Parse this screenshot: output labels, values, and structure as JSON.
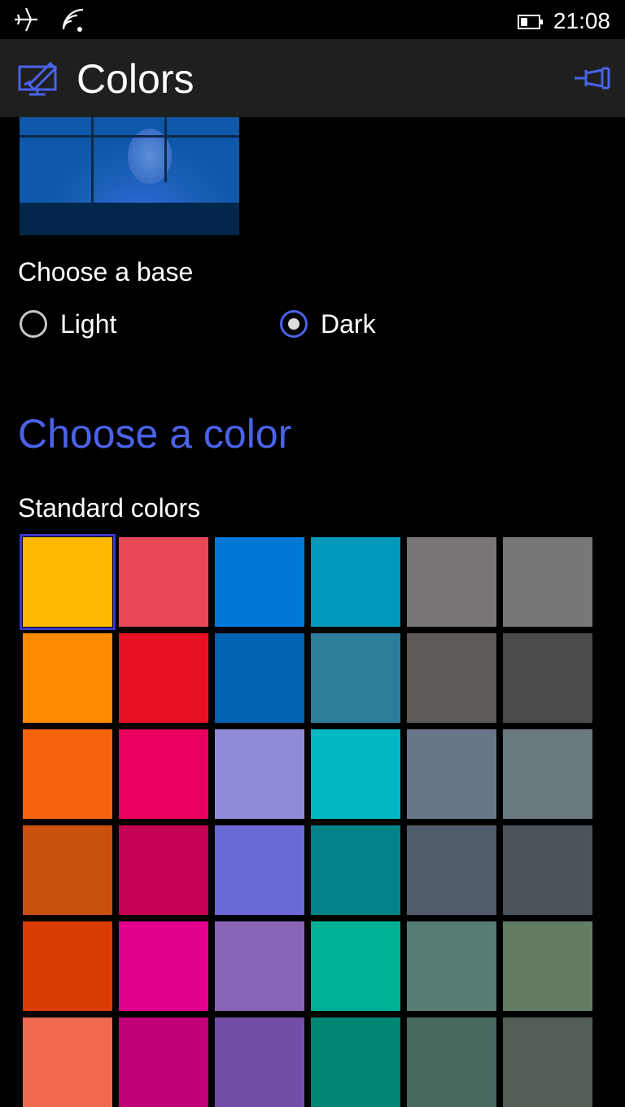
{
  "status_bar": {
    "time": "21:08",
    "icons": [
      "airplane-icon",
      "wifi-icon",
      "battery-icon"
    ]
  },
  "header": {
    "title": "Colors",
    "icon": "personalize-icon",
    "pin_icon": "pin-icon",
    "accent_color": "#4a63e8"
  },
  "base": {
    "label": "Choose a base",
    "options": [
      {
        "label": "Light",
        "selected": false
      },
      {
        "label": "Dark",
        "selected": true
      }
    ]
  },
  "color_section": {
    "heading": "Choose a color",
    "subheading": "Standard colors",
    "selected_index": 0,
    "swatches": [
      "#ffb900",
      "#e74856",
      "#0078d7",
      "#0099bc",
      "#7a7574",
      "#767676",
      "#ff8c00",
      "#e81123",
      "#0063b1",
      "#2d7d9a",
      "#5d5a58",
      "#4c4a48",
      "#f7630c",
      "#ea005e",
      "#8e8cd8",
      "#00b7c3",
      "#68768a",
      "#69797e",
      "#ca5010",
      "#c30052",
      "#6b69d6",
      "#038387",
      "#515c6b",
      "#4a5459",
      "#da3b01",
      "#e3008c",
      "#8764b8",
      "#00b294",
      "#567c73",
      "#647c64",
      "#ef6950",
      "#bf0077",
      "#744da9",
      "#018574",
      "#486860",
      "#525e54"
    ]
  }
}
